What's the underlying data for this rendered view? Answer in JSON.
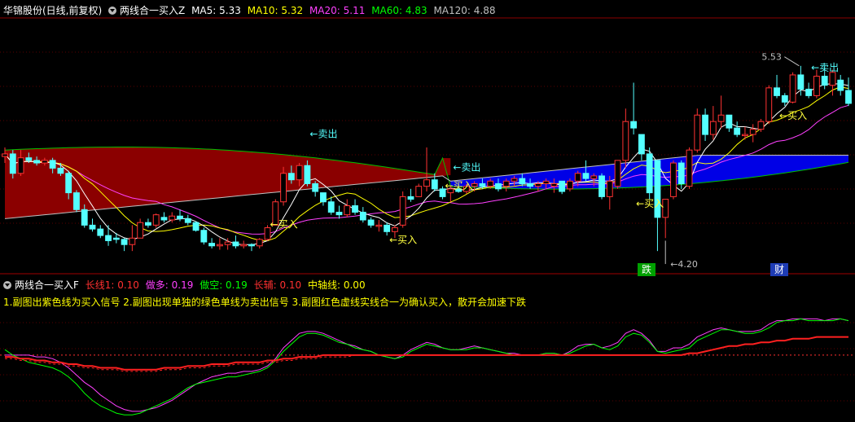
{
  "header": {
    "stock_title": "华锦股份(日线,前复权)",
    "indicator": "两线合一买入Z",
    "ma": [
      {
        "label": "MA5: 5.33",
        "color": "#ffffff"
      },
      {
        "label": "MA10: 5.32",
        "color": "#ffff00"
      },
      {
        "label": "MA20: 5.11",
        "color": "#ff40ff"
      },
      {
        "label": "MA60: 4.83",
        "color": "#00ff00"
      },
      {
        "label": "MA120: 4.88",
        "color": "#c0c0c0"
      }
    ]
  },
  "sub_header": {
    "indicator": "两线合一买入F",
    "items": [
      {
        "label": "长线1: 0.10",
        "color": "#ff3030"
      },
      {
        "label": "做多: 0.19",
        "color": "#ff40ff"
      },
      {
        "label": "做空: 0.19",
        "color": "#00ff00"
      },
      {
        "label": "长辅: 0.10",
        "color": "#ff3030"
      },
      {
        "label": "中轴线: 0.00",
        "color": "#ffff00"
      }
    ]
  },
  "note": "1.副图出紫色线为买入信号   2.副图出现单独的绿色单线为卖出信号   3.副图红色虚线实线合一为确认买入，散开会加速下跌",
  "colors": {
    "up": "#ff3232",
    "down": "#54ffff",
    "cloud_red": "#8b0000",
    "cloud_blue": "#0000e6",
    "signal_buy": "#ffff40",
    "signal_sell": "#54ffff"
  },
  "chart_data": [
    {
      "type": "candlestick",
      "price_range": [
        3.95,
        5.9
      ],
      "ohlc": [
        [
          4.83,
          4.9,
          4.78,
          4.85
        ],
        [
          4.85,
          4.88,
          4.66,
          4.7
        ],
        [
          4.7,
          4.88,
          4.68,
          4.82
        ],
        [
          4.82,
          4.86,
          4.78,
          4.8
        ],
        [
          4.8,
          4.83,
          4.76,
          4.78
        ],
        [
          4.78,
          4.82,
          4.76,
          4.8
        ],
        [
          4.8,
          4.82,
          4.7,
          4.74
        ],
        [
          4.74,
          4.78,
          4.68,
          4.7
        ],
        [
          4.7,
          4.72,
          4.5,
          4.55
        ],
        [
          4.55,
          4.57,
          4.4,
          4.42
        ],
        [
          4.42,
          4.46,
          4.28,
          4.3
        ],
        [
          4.3,
          4.35,
          4.25,
          4.27
        ],
        [
          4.27,
          4.3,
          4.2,
          4.22
        ],
        [
          4.22,
          4.3,
          4.14,
          4.18
        ],
        [
          4.2,
          4.24,
          4.16,
          4.19
        ],
        [
          4.19,
          4.2,
          4.1,
          4.15
        ],
        [
          4.15,
          4.3,
          4.1,
          4.2
        ],
        [
          4.2,
          4.35,
          4.2,
          4.32
        ],
        [
          4.32,
          4.35,
          4.28,
          4.3
        ],
        [
          4.3,
          4.39,
          4.28,
          4.38
        ],
        [
          4.36,
          4.4,
          4.32,
          4.34
        ],
        [
          4.34,
          4.4,
          4.32,
          4.37
        ],
        [
          4.37,
          4.42,
          4.33,
          4.35
        ],
        [
          4.35,
          4.38,
          4.3,
          4.32
        ],
        [
          4.32,
          4.33,
          4.25,
          4.26
        ],
        [
          4.26,
          4.28,
          4.15,
          4.17
        ],
        [
          4.16,
          4.2,
          4.12,
          4.14
        ],
        [
          4.14,
          4.2,
          4.11,
          4.15
        ],
        [
          4.15,
          4.2,
          4.11,
          4.17
        ],
        [
          4.17,
          4.22,
          4.12,
          4.14
        ],
        [
          4.14,
          4.18,
          4.12,
          4.15
        ],
        [
          4.15,
          4.16,
          4.1,
          4.14
        ],
        [
          4.14,
          4.2,
          4.12,
          4.19
        ],
        [
          4.19,
          4.3,
          4.18,
          4.28
        ],
        [
          4.3,
          4.5,
          4.3,
          4.48
        ],
        [
          4.48,
          4.75,
          4.45,
          4.7
        ],
        [
          4.7,
          4.76,
          4.62,
          4.65
        ],
        [
          4.65,
          4.78,
          4.6,
          4.76
        ],
        [
          4.76,
          4.8,
          4.6,
          4.62
        ],
        [
          4.62,
          4.64,
          4.52,
          4.56
        ],
        [
          4.55,
          4.55,
          4.45,
          4.48
        ],
        [
          4.48,
          4.52,
          4.38,
          4.4
        ],
        [
          4.4,
          4.45,
          4.35,
          4.38
        ],
        [
          4.38,
          4.5,
          4.36,
          4.45
        ],
        [
          4.45,
          4.5,
          4.38,
          4.4
        ],
        [
          4.4,
          4.44,
          4.32,
          4.34
        ],
        [
          4.34,
          4.36,
          4.28,
          4.3
        ],
        [
          4.3,
          4.34,
          4.25,
          4.3
        ],
        [
          4.3,
          4.32,
          4.22,
          4.25
        ],
        [
          4.25,
          4.3,
          4.2,
          4.28
        ],
        [
          4.3,
          4.56,
          4.28,
          4.52
        ],
        [
          4.52,
          4.58,
          4.48,
          4.5
        ],
        [
          4.52,
          4.62,
          4.52,
          4.6
        ],
        [
          4.6,
          4.9,
          4.56,
          4.65
        ],
        [
          4.65,
          4.7,
          4.56,
          4.58
        ],
        [
          4.58,
          4.6,
          4.5,
          4.52
        ],
        [
          4.55,
          4.6,
          4.48,
          4.58
        ],
        [
          4.58,
          4.62,
          4.55,
          4.56
        ],
        [
          4.56,
          4.62,
          4.54,
          4.6
        ],
        [
          4.6,
          4.64,
          4.56,
          4.62
        ],
        [
          4.62,
          4.66,
          4.58,
          4.6
        ],
        [
          4.6,
          4.66,
          4.58,
          4.64
        ],
        [
          4.62,
          4.66,
          4.56,
          4.58
        ],
        [
          4.6,
          4.66,
          4.56,
          4.64
        ],
        [
          4.64,
          4.68,
          4.6,
          4.66
        ],
        [
          4.66,
          4.7,
          4.6,
          4.62
        ],
        [
          4.62,
          4.66,
          4.58,
          4.6
        ],
        [
          4.6,
          4.64,
          4.56,
          4.62
        ],
        [
          4.62,
          4.66,
          4.58,
          4.64
        ],
        [
          4.6,
          4.66,
          4.55,
          4.62
        ],
        [
          4.64,
          4.64,
          4.54,
          4.56
        ],
        [
          4.58,
          4.66,
          4.56,
          4.64
        ],
        [
          4.64,
          4.72,
          4.6,
          4.7
        ],
        [
          4.7,
          4.8,
          4.64,
          4.66
        ],
        [
          4.66,
          4.7,
          4.6,
          4.68
        ],
        [
          4.68,
          4.7,
          4.5,
          4.52
        ],
        [
          4.52,
          4.68,
          4.42,
          4.64
        ],
        [
          4.6,
          4.8,
          4.58,
          4.8
        ],
        [
          4.8,
          5.2,
          4.74,
          5.1
        ],
        [
          5.1,
          5.4,
          5.0,
          5.05
        ],
        [
          5.0,
          5.0,
          4.8,
          4.85
        ],
        [
          4.85,
          4.9,
          4.5,
          4.55
        ],
        [
          4.8,
          4.8,
          4.1,
          4.36
        ],
        [
          4.36,
          4.5,
          4.2,
          4.5
        ],
        [
          4.52,
          4.8,
          4.5,
          4.78
        ],
        [
          4.78,
          4.8,
          4.58,
          4.62
        ],
        [
          4.6,
          4.9,
          4.58,
          4.88
        ],
        [
          4.88,
          5.2,
          4.86,
          5.15
        ],
        [
          5.15,
          5.2,
          4.95,
          5.0
        ],
        [
          5.0,
          5.22,
          4.96,
          5.1
        ],
        [
          5.1,
          5.3,
          5.05,
          5.15
        ],
        [
          5.15,
          5.15,
          5.02,
          5.05
        ],
        [
          5.05,
          5.1,
          4.98,
          5.0
        ],
        [
          5.0,
          5.06,
          4.96,
          5.0
        ],
        [
          5.0,
          5.08,
          4.94,
          5.04
        ],
        [
          5.04,
          5.12,
          5.02,
          5.1
        ],
        [
          5.1,
          5.38,
          5.08,
          5.36
        ],
        [
          5.36,
          5.46,
          5.28,
          5.3
        ],
        [
          5.3,
          5.32,
          5.22,
          5.25
        ],
        [
          5.25,
          5.48,
          5.24,
          5.46
        ],
        [
          5.46,
          5.53,
          5.3,
          5.35
        ],
        [
          5.35,
          5.4,
          5.28,
          5.3
        ],
        [
          5.3,
          5.5,
          5.28,
          5.45
        ],
        [
          5.45,
          5.53,
          5.35,
          5.38
        ],
        [
          5.38,
          5.5,
          5.3,
          5.48
        ],
        [
          5.42,
          5.46,
          5.3,
          5.34
        ],
        [
          5.34,
          5.44,
          5.22,
          5.24
        ]
      ],
      "highest": {
        "label": "5.53",
        "candle": 100
      },
      "lowest": {
        "label": "4.20",
        "candle": 83
      },
      "signals": [
        {
          "label": "←卖出",
          "type": "sell",
          "candle": 38,
          "price": 4.98
        },
        {
          "label": "←买入",
          "type": "buy",
          "candle": 33,
          "price": 4.28
        },
        {
          "label": "←买入",
          "type": "buy",
          "candle": 48,
          "price": 4.16
        },
        {
          "label": "←卖出",
          "type": "sell",
          "candle": 56,
          "price": 4.72
        },
        {
          "label": "←买入",
          "type": "buy",
          "candle": 55,
          "price": 4.58
        },
        {
          "label": "←买入",
          "type": "buy",
          "candle": 79,
          "price": 4.44
        },
        {
          "label": "←买入",
          "type": "buy",
          "candle": 97,
          "price": 5.12
        },
        {
          "label": "←卖出",
          "type": "sell",
          "candle": 101,
          "price": 5.49
        }
      ],
      "markers": [
        {
          "label": "跌",
          "candle": 81,
          "color": "#00a000"
        },
        {
          "label": "财",
          "candle": 96,
          "color": "#1e3cb4"
        }
      ]
    },
    {
      "type": "line",
      "series": [
        {
          "name": "做多",
          "values": [
            0.0,
            0.0,
            0.0,
            0.0,
            -0.01,
            -0.01,
            -0.02,
            -0.04,
            -0.07,
            -0.11,
            -0.15,
            -0.18,
            -0.22,
            -0.25,
            -0.28,
            -0.3,
            -0.31,
            -0.31,
            -0.3,
            -0.29,
            -0.27,
            -0.25,
            -0.22,
            -0.19,
            -0.16,
            -0.14,
            -0.12,
            -0.11,
            -0.1,
            -0.1,
            -0.09,
            -0.09,
            -0.08,
            -0.06,
            -0.02,
            0.04,
            0.08,
            0.12,
            0.13,
            0.13,
            0.12,
            0.1,
            0.08,
            0.06,
            0.05,
            0.03,
            0.02,
            0.0,
            -0.01,
            -0.02,
            0.0,
            0.03,
            0.05,
            0.07,
            0.06,
            0.04,
            0.03,
            0.03,
            0.04,
            0.05,
            0.04,
            0.03,
            0.02,
            0.01,
            0.01,
            0.0,
            0.0,
            0.0,
            0.01,
            0.01,
            0.0,
            0.02,
            0.05,
            0.06,
            0.06,
            0.04,
            0.05,
            0.07,
            0.12,
            0.14,
            0.12,
            0.08,
            0.02,
            0.02,
            0.04,
            0.04,
            0.06,
            0.1,
            0.12,
            0.14,
            0.15,
            0.14,
            0.13,
            0.13,
            0.13,
            0.14,
            0.17,
            0.19,
            0.19,
            0.2,
            0.2,
            0.2,
            0.2,
            0.19,
            0.2,
            0.2,
            0.19
          ]
        },
        {
          "name": "做空",
          "values": [
            0.03,
            0.0,
            -0.02,
            -0.04,
            -0.05,
            -0.06,
            -0.07,
            -0.09,
            -0.12,
            -0.16,
            -0.21,
            -0.25,
            -0.28,
            -0.3,
            -0.32,
            -0.33,
            -0.33,
            -0.32,
            -0.3,
            -0.28,
            -0.26,
            -0.24,
            -0.21,
            -0.18,
            -0.16,
            -0.15,
            -0.14,
            -0.13,
            -0.12,
            -0.12,
            -0.11,
            -0.1,
            -0.09,
            -0.07,
            -0.03,
            0.02,
            0.06,
            0.1,
            0.12,
            0.12,
            0.11,
            0.09,
            0.07,
            0.06,
            0.04,
            0.03,
            0.02,
            0.0,
            -0.01,
            -0.02,
            -0.01,
            0.02,
            0.04,
            0.06,
            0.05,
            0.04,
            0.03,
            0.03,
            0.03,
            0.04,
            0.04,
            0.03,
            0.02,
            0.01,
            0.0,
            0.0,
            0.0,
            0.0,
            0.01,
            0.01,
            0.0,
            0.01,
            0.03,
            0.05,
            0.06,
            0.04,
            0.03,
            0.05,
            0.1,
            0.12,
            0.11,
            0.07,
            0.02,
            0.01,
            0.02,
            0.03,
            0.04,
            0.08,
            0.1,
            0.12,
            0.14,
            0.14,
            0.13,
            0.12,
            0.12,
            0.13,
            0.15,
            0.18,
            0.19,
            0.19,
            0.2,
            0.19,
            0.19,
            0.19,
            0.19,
            0.2,
            0.19
          ]
        },
        {
          "name": "长线1",
          "values": [
            -0.01,
            -0.01,
            -0.02,
            -0.02,
            -0.03,
            -0.03,
            -0.04,
            -0.04,
            -0.05,
            -0.05,
            -0.06,
            -0.06,
            -0.07,
            -0.07,
            -0.07,
            -0.08,
            -0.08,
            -0.08,
            -0.08,
            -0.08,
            -0.07,
            -0.07,
            -0.07,
            -0.06,
            -0.06,
            -0.06,
            -0.05,
            -0.05,
            -0.05,
            -0.04,
            -0.04,
            -0.04,
            -0.04,
            -0.03,
            -0.03,
            -0.02,
            -0.02,
            -0.01,
            -0.01,
            -0.01,
            0.0,
            0.0,
            0.0,
            0.0,
            0.0,
            0.0,
            0.0,
            0.0,
            0.0,
            0.0,
            0.0,
            0.0,
            0.0,
            0.0,
            0.0,
            0.0,
            0.0,
            0.0,
            0.0,
            0.0,
            0.0,
            0.0,
            0.0,
            0.0,
            0.0,
            0.0,
            0.0,
            0.0,
            0.0,
            0.0,
            0.0,
            0.0,
            0.0,
            0.0,
            0.0,
            0.0,
            0.0,
            0.0,
            0.0,
            0.0,
            0.0,
            0.0,
            0.0,
            0.0,
            0.0,
            0.0,
            0.01,
            0.01,
            0.02,
            0.03,
            0.04,
            0.05,
            0.05,
            0.06,
            0.06,
            0.07,
            0.07,
            0.08,
            0.08,
            0.09,
            0.09,
            0.09,
            0.1,
            0.1,
            0.1,
            0.1,
            0.1
          ]
        },
        {
          "name": "长辅",
          "values": [
            -0.02,
            -0.02,
            -0.03,
            -0.03,
            -0.04,
            -0.04,
            -0.05,
            -0.05,
            -0.06,
            -0.06,
            -0.07,
            -0.07,
            -0.08,
            -0.08,
            -0.08,
            -0.09,
            -0.09,
            -0.09,
            -0.09,
            -0.09,
            -0.08,
            -0.08,
            -0.08,
            -0.07,
            -0.07,
            -0.07,
            -0.06,
            -0.06,
            -0.06,
            -0.05,
            -0.05,
            -0.05,
            -0.05,
            -0.04,
            -0.04,
            -0.03,
            -0.03,
            -0.02,
            -0.02,
            -0.02,
            -0.01,
            -0.01,
            -0.01,
            -0.01,
            0.0,
            0.0,
            0.0,
            0.0,
            0.0,
            0.0,
            0.0,
            0.0,
            0.0,
            0.0,
            0.0,
            0.0,
            0.0,
            0.0,
            0.0,
            0.0,
            0.0,
            0.0,
            0.0,
            0.0,
            0.0,
            0.0,
            0.0,
            0.0,
            0.0,
            0.0,
            0.0,
            0.0,
            0.0,
            0.0,
            0.0,
            0.0,
            0.0,
            0.0,
            0.0,
            0.0,
            0.0,
            0.0,
            0.0,
            0.0,
            0.0,
            0.0,
            0.01,
            0.01,
            0.02,
            0.03,
            0.04,
            0.05,
            0.05,
            0.06,
            0.06,
            0.07,
            0.07,
            0.08,
            0.08,
            0.09,
            0.09,
            0.09,
            0.1,
            0.1,
            0.1,
            0.1,
            0.1
          ]
        }
      ],
      "ylim": [
        -0.36,
        0.26
      ]
    }
  ]
}
